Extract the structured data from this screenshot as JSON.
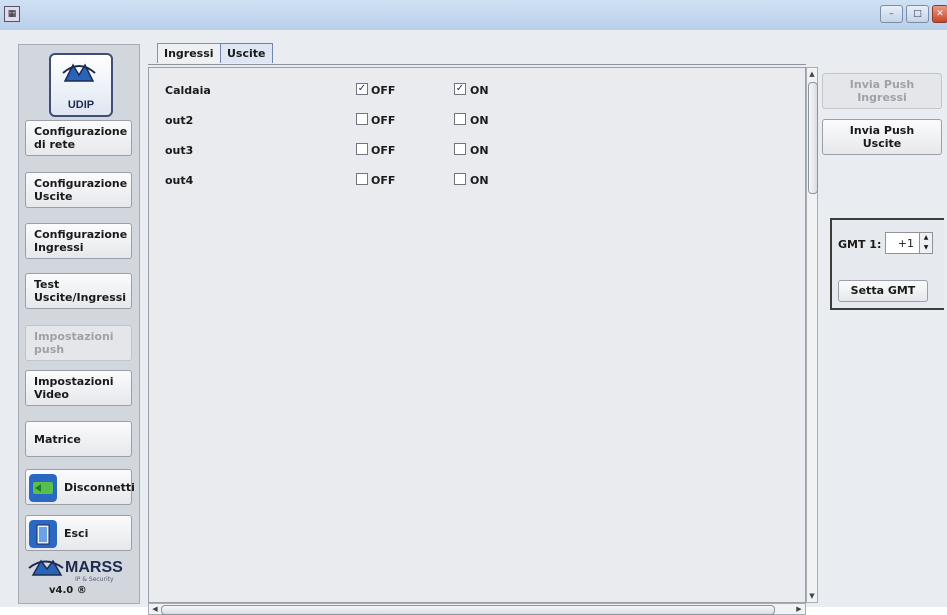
{
  "window": {
    "title_icon": "app-icon",
    "controls": [
      "minimize-icon",
      "maximize-icon",
      "close-icon"
    ]
  },
  "sidebar": {
    "logo_text": "UDIP",
    "items": [
      {
        "label": "Configurazione\ndi rete",
        "enabled": true
      },
      {
        "label": "Configurazione\nUscite",
        "enabled": true
      },
      {
        "label": "Configurazione\nIngressi",
        "enabled": true
      },
      {
        "label": "Test\nUscite/Ingressi",
        "enabled": true
      },
      {
        "label": "Impostazioni\npush",
        "enabled": false
      },
      {
        "label": "Impostazioni\nVideo",
        "enabled": true
      },
      {
        "label": "Matrice",
        "enabled": true
      }
    ],
    "disconnect_label": "Disconnetti",
    "exit_label": "Esci",
    "brand": "MARSS",
    "brand_sub": "IP & Security",
    "version": "v4.0 ®"
  },
  "tabs": [
    {
      "label": "Ingressi",
      "active": false
    },
    {
      "label": "Uscite",
      "active": true
    }
  ],
  "outputs": [
    {
      "name": "Caldaia",
      "off_checked": true,
      "on_checked": true,
      "off_label": "OFF",
      "on_label": "ON"
    },
    {
      "name": "out2",
      "off_checked": false,
      "on_checked": false,
      "off_label": "OFF",
      "on_label": "ON"
    },
    {
      "name": "out3",
      "off_checked": false,
      "on_checked": false,
      "off_label": "OFF",
      "on_label": "ON"
    },
    {
      "name": "out4",
      "off_checked": false,
      "on_checked": false,
      "off_label": "OFF",
      "on_label": "ON"
    }
  ],
  "right_panel": {
    "push_inputs_label": "Invia Push\nIngressi",
    "push_inputs_enabled": false,
    "push_outputs_label": "Invia Push\nUscite",
    "gmt_label": "GMT 1:",
    "gmt_value": "+1",
    "set_gmt_label": "Setta GMT"
  },
  "colors": {
    "accent": "#3e4e75",
    "check": "#1a2f6a",
    "disabled_text": "#9ea2a8"
  }
}
